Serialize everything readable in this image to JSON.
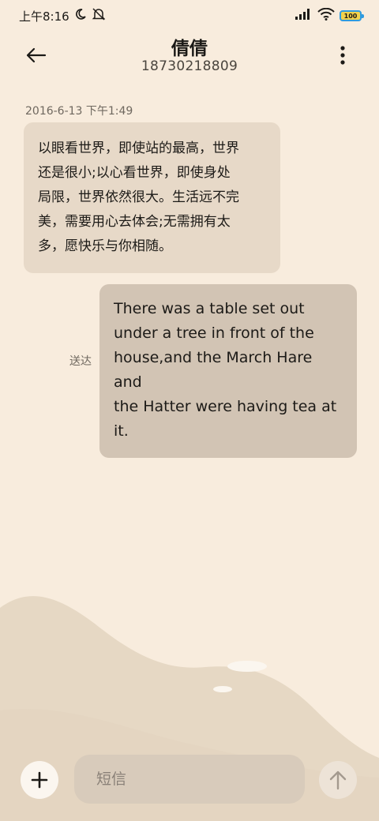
{
  "status_bar": {
    "time": "上午8:16",
    "battery": "100",
    "icons": [
      "moon-icon",
      "bell-muted-icon",
      "signal-icon",
      "wifi-icon",
      "battery-icon"
    ]
  },
  "header": {
    "contact_name": "倩倩",
    "phone_number": "18730218809",
    "back_icon": "back-arrow-icon",
    "more_icon": "more-vertical-icon"
  },
  "conversation": {
    "timestamp": "2016-6-13 下午1:49",
    "messages": [
      {
        "direction": "incoming",
        "lines": [
          "以眼看世界，即使站的最高，世界",
          "还是很小;以心看世界，即使身处",
          "局限，世界依然很大。生活远不完",
          "美，需要用心去体会;无需拥有太",
          "多，愿快乐与你相随。"
        ]
      },
      {
        "direction": "outgoing",
        "status": "送达",
        "lines": [
          "There was a table set out",
          "under a tree in front of the",
          "house,and the March Hare and",
          "the Hatter were having tea at",
          "it."
        ]
      }
    ]
  },
  "composer": {
    "placeholder": "短信",
    "value": "",
    "add_icon": "plus-icon",
    "send_icon": "send-arrow-up-icon"
  },
  "colors": {
    "background": "#f8ecdd",
    "incoming_bubble": "#e7d9c8",
    "outgoing_bubble": "#d2c4b4",
    "hills": "#e6d8c4"
  }
}
